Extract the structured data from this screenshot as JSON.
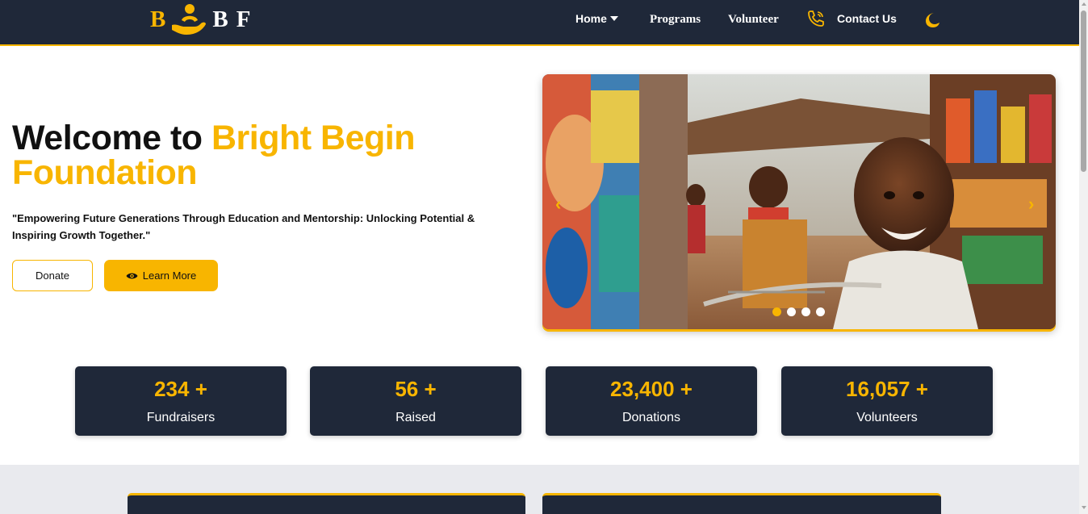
{
  "brand": {
    "letter1": "B",
    "letter2": "B",
    "letter3": "F"
  },
  "nav": {
    "home": "Home",
    "programs": "Programs",
    "volunteer": "Volunteer",
    "contact": "Contact Us"
  },
  "hero": {
    "title_plain": "Welcome to ",
    "title_accent_1": "Bright Begin",
    "title_accent_2": "Foundation",
    "quote": "\"Empowering Future Generations Through Education and Mentorship: Unlocking Potential & Inspiring Growth Together.\"",
    "donate_label": "Donate",
    "learn_label": "Learn More"
  },
  "carousel": {
    "prev": "‹",
    "next": "›",
    "slide_count": 4,
    "active_slide": 1
  },
  "stats": [
    {
      "value": "234 +",
      "label": "Fundraisers"
    },
    {
      "value": "56 +",
      "label": "Raised"
    },
    {
      "value": "23,400 +",
      "label": "Donations"
    },
    {
      "value": "16,057 +",
      "label": "Volunteers"
    }
  ],
  "colors": {
    "navy": "#1f2839",
    "accent": "#f8b500"
  }
}
